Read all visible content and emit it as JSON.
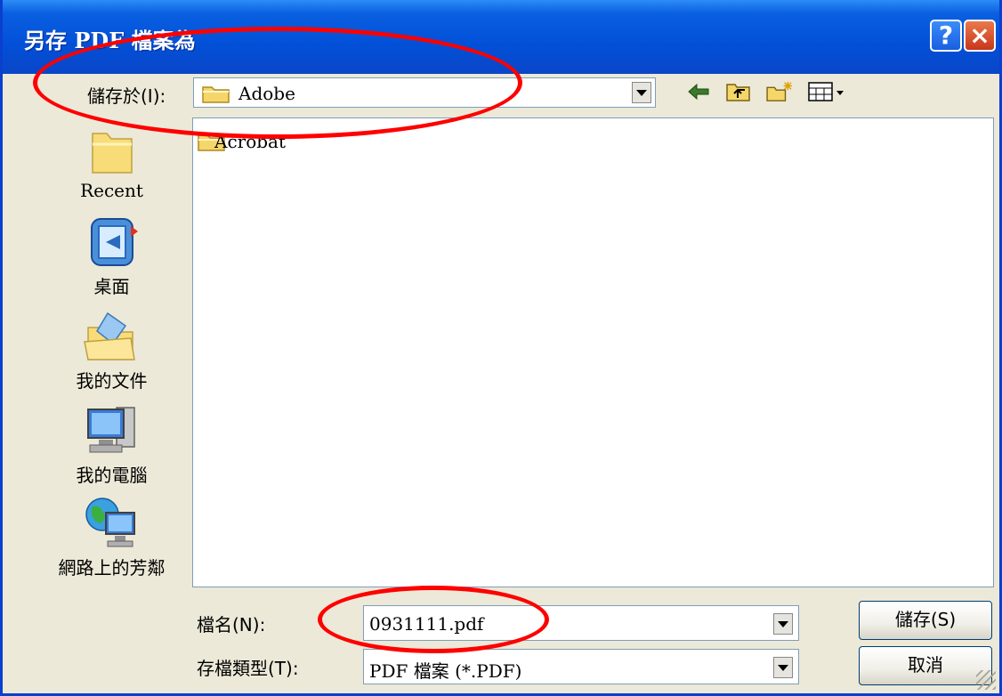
{
  "window": {
    "title": "另存 PDF 檔案為",
    "help_label": "?",
    "close_label": "×"
  },
  "save_in": {
    "label": "儲存於(I):",
    "value": "Adobe"
  },
  "toolbar": {
    "icons": [
      "back-arrow-icon",
      "up-folder-icon",
      "new-folder-icon",
      "view-menu-icon"
    ]
  },
  "places": [
    {
      "label": "Recent",
      "icon": "recent-folder-icon"
    },
    {
      "label": "桌面",
      "icon": "desktop-icon"
    },
    {
      "label": "我的文件",
      "icon": "my-documents-icon"
    },
    {
      "label": "我的電腦",
      "icon": "my-computer-icon"
    },
    {
      "label": "網路上的芳鄰",
      "icon": "network-places-icon"
    }
  ],
  "files": [
    {
      "name": "Acrobat",
      "icon": "folder-icon"
    }
  ],
  "filename": {
    "label": "檔名(N):",
    "value": "0931111.pdf"
  },
  "filetype": {
    "label": "存檔類型(T):",
    "value": "PDF 檔案 (*.PDF)"
  },
  "buttons": {
    "save": "儲存(S)",
    "cancel": "取消"
  },
  "colors": {
    "titlebar": "#0250d8",
    "highlight_oval": "#ff0000"
  }
}
